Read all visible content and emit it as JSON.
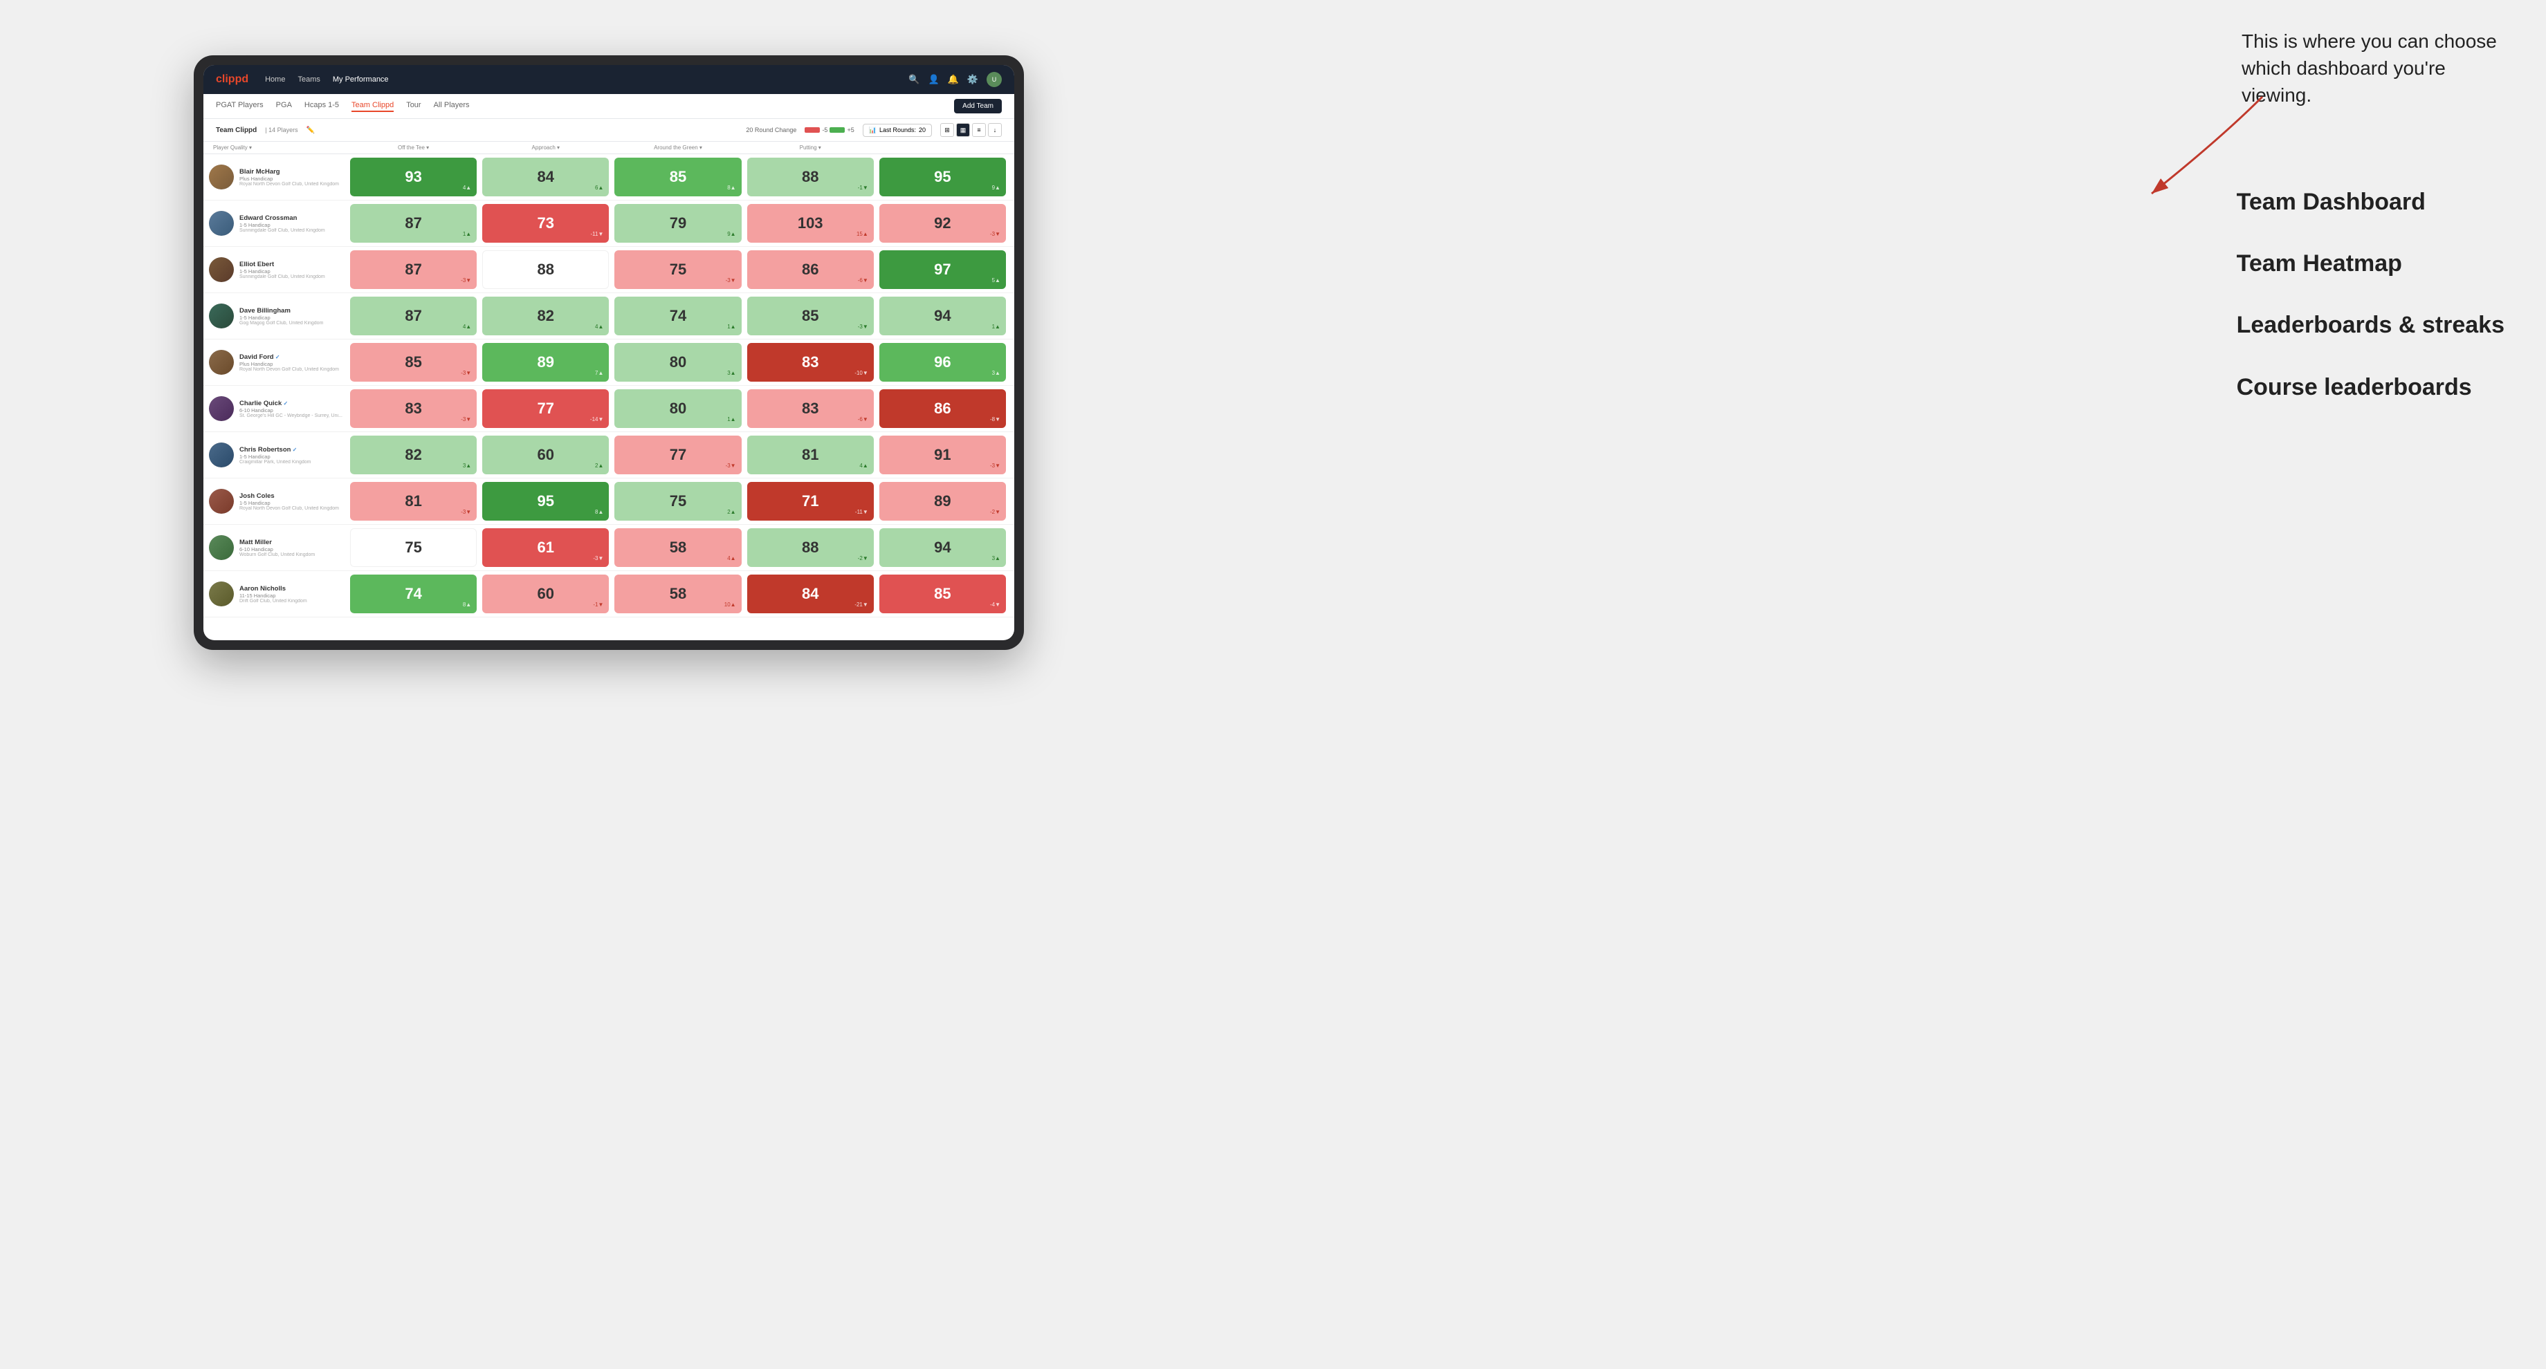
{
  "annotation": {
    "intro_text": "This is where you can choose which dashboard you're viewing.",
    "options": [
      "Team Dashboard",
      "Team Heatmap",
      "Leaderboards & streaks",
      "Course leaderboards"
    ]
  },
  "nav": {
    "logo": "clippd",
    "links": [
      "Home",
      "Teams",
      "My Performance"
    ],
    "active_link": "My Performance"
  },
  "sub_nav": {
    "tabs": [
      "PGAT Players",
      "PGA",
      "Hcaps 1-5",
      "Team Clippd",
      "Tour",
      "All Players"
    ],
    "active_tab": "Team Clippd",
    "add_team_label": "Add Team"
  },
  "team_info": {
    "name": "Team Clippd",
    "separator": "|",
    "count": "14 Players",
    "round_change_label": "20 Round Change",
    "neg_label": "-5",
    "pos_label": "+5",
    "last_rounds_label": "Last Rounds:",
    "last_rounds_value": "20"
  },
  "columns": {
    "headers": [
      "Player Quality ▾",
      "Off the Tee ▾",
      "Approach ▾",
      "Around the Green ▾",
      "Putting ▾"
    ]
  },
  "players": [
    {
      "name": "Blair McHarg",
      "handicap": "Plus Handicap",
      "club": "Royal North Devon Golf Club, United Kingdom",
      "verified": false,
      "scores": [
        {
          "value": "93",
          "change": "4▲",
          "bg": "bg-green-dark"
        },
        {
          "value": "84",
          "change": "6▲",
          "bg": "bg-green-light"
        },
        {
          "value": "85",
          "change": "8▲",
          "bg": "bg-green-med"
        },
        {
          "value": "88",
          "change": "-1▼",
          "bg": "bg-green-light"
        },
        {
          "value": "95",
          "change": "9▲",
          "bg": "bg-green-dark"
        }
      ]
    },
    {
      "name": "Edward Crossman",
      "handicap": "1-5 Handicap",
      "club": "Sunningdale Golf Club, United Kingdom",
      "verified": false,
      "scores": [
        {
          "value": "87",
          "change": "1▲",
          "bg": "bg-green-light"
        },
        {
          "value": "73",
          "change": "-11▼",
          "bg": "bg-red-med"
        },
        {
          "value": "79",
          "change": "9▲",
          "bg": "bg-green-light"
        },
        {
          "value": "103",
          "change": "15▲",
          "bg": "bg-red-light"
        },
        {
          "value": "92",
          "change": "-3▼",
          "bg": "bg-red-light"
        }
      ]
    },
    {
      "name": "Elliot Ebert",
      "handicap": "1-5 Handicap",
      "club": "Sunningdale Golf Club, United Kingdom",
      "verified": false,
      "scores": [
        {
          "value": "87",
          "change": "-3▼",
          "bg": "bg-red-light"
        },
        {
          "value": "88",
          "change": "",
          "bg": "bg-white"
        },
        {
          "value": "75",
          "change": "-3▼",
          "bg": "bg-red-light"
        },
        {
          "value": "86",
          "change": "-6▼",
          "bg": "bg-red-light"
        },
        {
          "value": "97",
          "change": "5▲",
          "bg": "bg-green-dark"
        }
      ]
    },
    {
      "name": "Dave Billingham",
      "handicap": "1-5 Handicap",
      "club": "Gog Magog Golf Club, United Kingdom",
      "verified": false,
      "scores": [
        {
          "value": "87",
          "change": "4▲",
          "bg": "bg-green-light"
        },
        {
          "value": "82",
          "change": "4▲",
          "bg": "bg-green-light"
        },
        {
          "value": "74",
          "change": "1▲",
          "bg": "bg-green-light"
        },
        {
          "value": "85",
          "change": "-3▼",
          "bg": "bg-green-light"
        },
        {
          "value": "94",
          "change": "1▲",
          "bg": "bg-green-light"
        }
      ]
    },
    {
      "name": "David Ford",
      "handicap": "Plus Handicap",
      "club": "Royal North Devon Golf Club, United Kingdom",
      "verified": true,
      "scores": [
        {
          "value": "85",
          "change": "-3▼",
          "bg": "bg-red-light"
        },
        {
          "value": "89",
          "change": "7▲",
          "bg": "bg-green-med"
        },
        {
          "value": "80",
          "change": "3▲",
          "bg": "bg-green-light"
        },
        {
          "value": "83",
          "change": "-10▼",
          "bg": "bg-red-dark"
        },
        {
          "value": "96",
          "change": "3▲",
          "bg": "bg-green-med"
        }
      ]
    },
    {
      "name": "Charlie Quick",
      "handicap": "6-10 Handicap",
      "club": "St. George's Hill GC - Weybridge - Surrey, Uni...",
      "verified": true,
      "scores": [
        {
          "value": "83",
          "change": "-3▼",
          "bg": "bg-red-light"
        },
        {
          "value": "77",
          "change": "-14▼",
          "bg": "bg-red-med"
        },
        {
          "value": "80",
          "change": "1▲",
          "bg": "bg-green-light"
        },
        {
          "value": "83",
          "change": "-6▼",
          "bg": "bg-red-light"
        },
        {
          "value": "86",
          "change": "-8▼",
          "bg": "bg-red-dark"
        }
      ]
    },
    {
      "name": "Chris Robertson",
      "handicap": "1-5 Handicap",
      "club": "Craigmillar Park, United Kingdom",
      "verified": true,
      "scores": [
        {
          "value": "82",
          "change": "3▲",
          "bg": "bg-green-light"
        },
        {
          "value": "60",
          "change": "2▲",
          "bg": "bg-green-light"
        },
        {
          "value": "77",
          "change": "-3▼",
          "bg": "bg-red-light"
        },
        {
          "value": "81",
          "change": "4▲",
          "bg": "bg-green-light"
        },
        {
          "value": "91",
          "change": "-3▼",
          "bg": "bg-red-light"
        }
      ]
    },
    {
      "name": "Josh Coles",
      "handicap": "1-5 Handicap",
      "club": "Royal North Devon Golf Club, United Kingdom",
      "verified": false,
      "scores": [
        {
          "value": "81",
          "change": "-3▼",
          "bg": "bg-red-light"
        },
        {
          "value": "95",
          "change": "8▲",
          "bg": "bg-green-dark"
        },
        {
          "value": "75",
          "change": "2▲",
          "bg": "bg-green-light"
        },
        {
          "value": "71",
          "change": "-11▼",
          "bg": "bg-red-dark"
        },
        {
          "value": "89",
          "change": "-2▼",
          "bg": "bg-red-light"
        }
      ]
    },
    {
      "name": "Matt Miller",
      "handicap": "6-10 Handicap",
      "club": "Woburn Golf Club, United Kingdom",
      "verified": false,
      "scores": [
        {
          "value": "75",
          "change": "",
          "bg": "bg-white"
        },
        {
          "value": "61",
          "change": "-3▼",
          "bg": "bg-red-med"
        },
        {
          "value": "58",
          "change": "4▲",
          "bg": "bg-red-light"
        },
        {
          "value": "88",
          "change": "-2▼",
          "bg": "bg-green-light"
        },
        {
          "value": "94",
          "change": "3▲",
          "bg": "bg-green-light"
        }
      ]
    },
    {
      "name": "Aaron Nicholls",
      "handicap": "11-15 Handicap",
      "club": "Drift Golf Club, United Kingdom",
      "verified": false,
      "scores": [
        {
          "value": "74",
          "change": "8▲",
          "bg": "bg-green-med"
        },
        {
          "value": "60",
          "change": "-1▼",
          "bg": "bg-red-light"
        },
        {
          "value": "58",
          "change": "10▲",
          "bg": "bg-red-light"
        },
        {
          "value": "84",
          "change": "-21▼",
          "bg": "bg-red-dark"
        },
        {
          "value": "85",
          "change": "-4▼",
          "bg": "bg-red-med"
        }
      ]
    }
  ]
}
